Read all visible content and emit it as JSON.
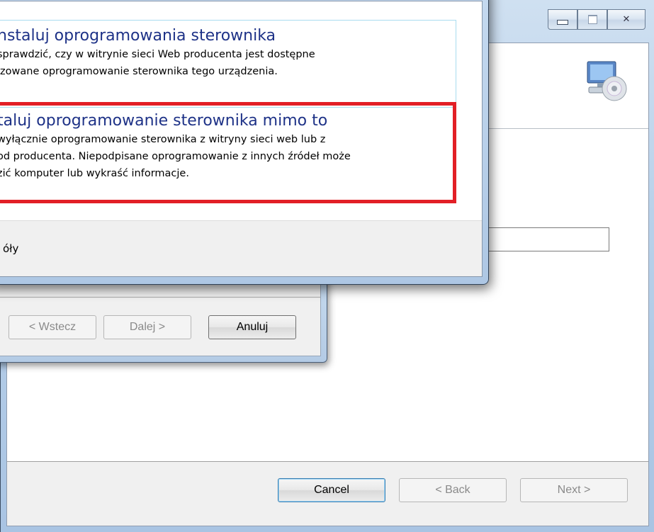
{
  "back_window": {
    "caption_buttons": {
      "minimize": "minimize",
      "maximize": "maximize",
      "close": "close"
    },
    "buttons": {
      "cancel": "Cancel",
      "back": "< Back",
      "next": "Next >"
    },
    "icon": "monitor-cd-icon"
  },
  "middle_dialog": {
    "buttons": {
      "back": "< Wstecz",
      "next": "Dalej >",
      "cancel": "Anuluj"
    }
  },
  "front_dialog": {
    "option1": {
      "title": "nstaluj oprogramowania sterownika",
      "line1": "sprawdzić, czy w witrynie sieci Web producenta jest dostępne",
      "line2": "izowane oprogramowanie sterownika tego urządzenia."
    },
    "option2": {
      "title": "taluj oprogramowanie sterownika mimo to",
      "line1": "wyłącznie oprogramowanie sterownika z witryny sieci web lub z",
      "line2": "od producenta. Niepodpisane oprogramowanie z innych źródeł może",
      "line3": "zić komputer lub wykraść informacje.",
      "highlight_color": "#e21f26"
    },
    "details_label": "óły"
  }
}
